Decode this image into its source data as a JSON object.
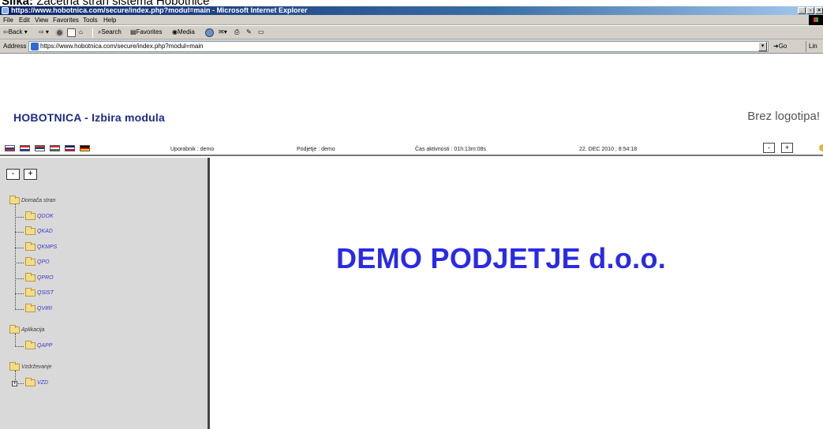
{
  "caption": {
    "label": "Slika:",
    "text": " Začetna stran sistema Hobotnice"
  },
  "window": {
    "title": "https://www.hobotnica.com/secure/index.php?modul=main - Microsoft Internet Explorer",
    "min": "_",
    "max": "▫",
    "close": "×"
  },
  "menu": {
    "file": "File",
    "edit": "Edit",
    "view": "View",
    "favorites": "Favorites",
    "tools": "Tools",
    "help": "Help"
  },
  "toolbar": {
    "back": "Back",
    "search": "Search",
    "favorites": "Favorites",
    "media": "Media"
  },
  "address": {
    "label": "Address",
    "url": "https://www.hobotnica.com/secure/index.php?modul=main",
    "go": "Go",
    "links": "Lin"
  },
  "header": {
    "app_title": "HOBOTNICA - Izbira modula",
    "logo_placeholder": "Brez logotipa!"
  },
  "status": {
    "user": "Uporabnik : demo",
    "company": "Podjetje : demo",
    "activity": "Čas aktivnosti :    01h:13m:08s",
    "datetime": "22. DEC 2010 ; 8:54:18",
    "minus": "-",
    "plus": "+"
  },
  "flags": [
    {
      "name": "slovenian",
      "colors": [
        "#ffffff",
        "#1c3aa8",
        "#d8232a"
      ]
    },
    {
      "name": "croatian",
      "colors": [
        "#d8232a",
        "#ffffff",
        "#1c3aa8"
      ]
    },
    {
      "name": "serbian",
      "colors": [
        "#c6363c",
        "#0c4076",
        "#ffffff"
      ]
    },
    {
      "name": "hungarian",
      "colors": [
        "#ce2939",
        "#ffffff",
        "#477050"
      ]
    },
    {
      "name": "british",
      "colors": [
        "#012169",
        "#ffffff",
        "#c8102e"
      ]
    },
    {
      "name": "german",
      "colors": [
        "#000000",
        "#dd0000",
        "#ffce00"
      ]
    }
  ],
  "tree": {
    "collapse": "-",
    "expand": "+",
    "groups": [
      {
        "label": "Domača stran",
        "items": [
          "QDOK",
          "QKAD",
          "QKMPS",
          "QPO",
          "QPRO",
          "QSIST",
          "QVIRI"
        ]
      },
      {
        "label": "Aplikacija",
        "items": [
          "QAPP"
        ]
      },
      {
        "label": "Vzdrževanje",
        "items": [
          "VZD"
        ]
      }
    ]
  },
  "content": {
    "company_name": "DEMO PODJETJE d.o.o."
  }
}
